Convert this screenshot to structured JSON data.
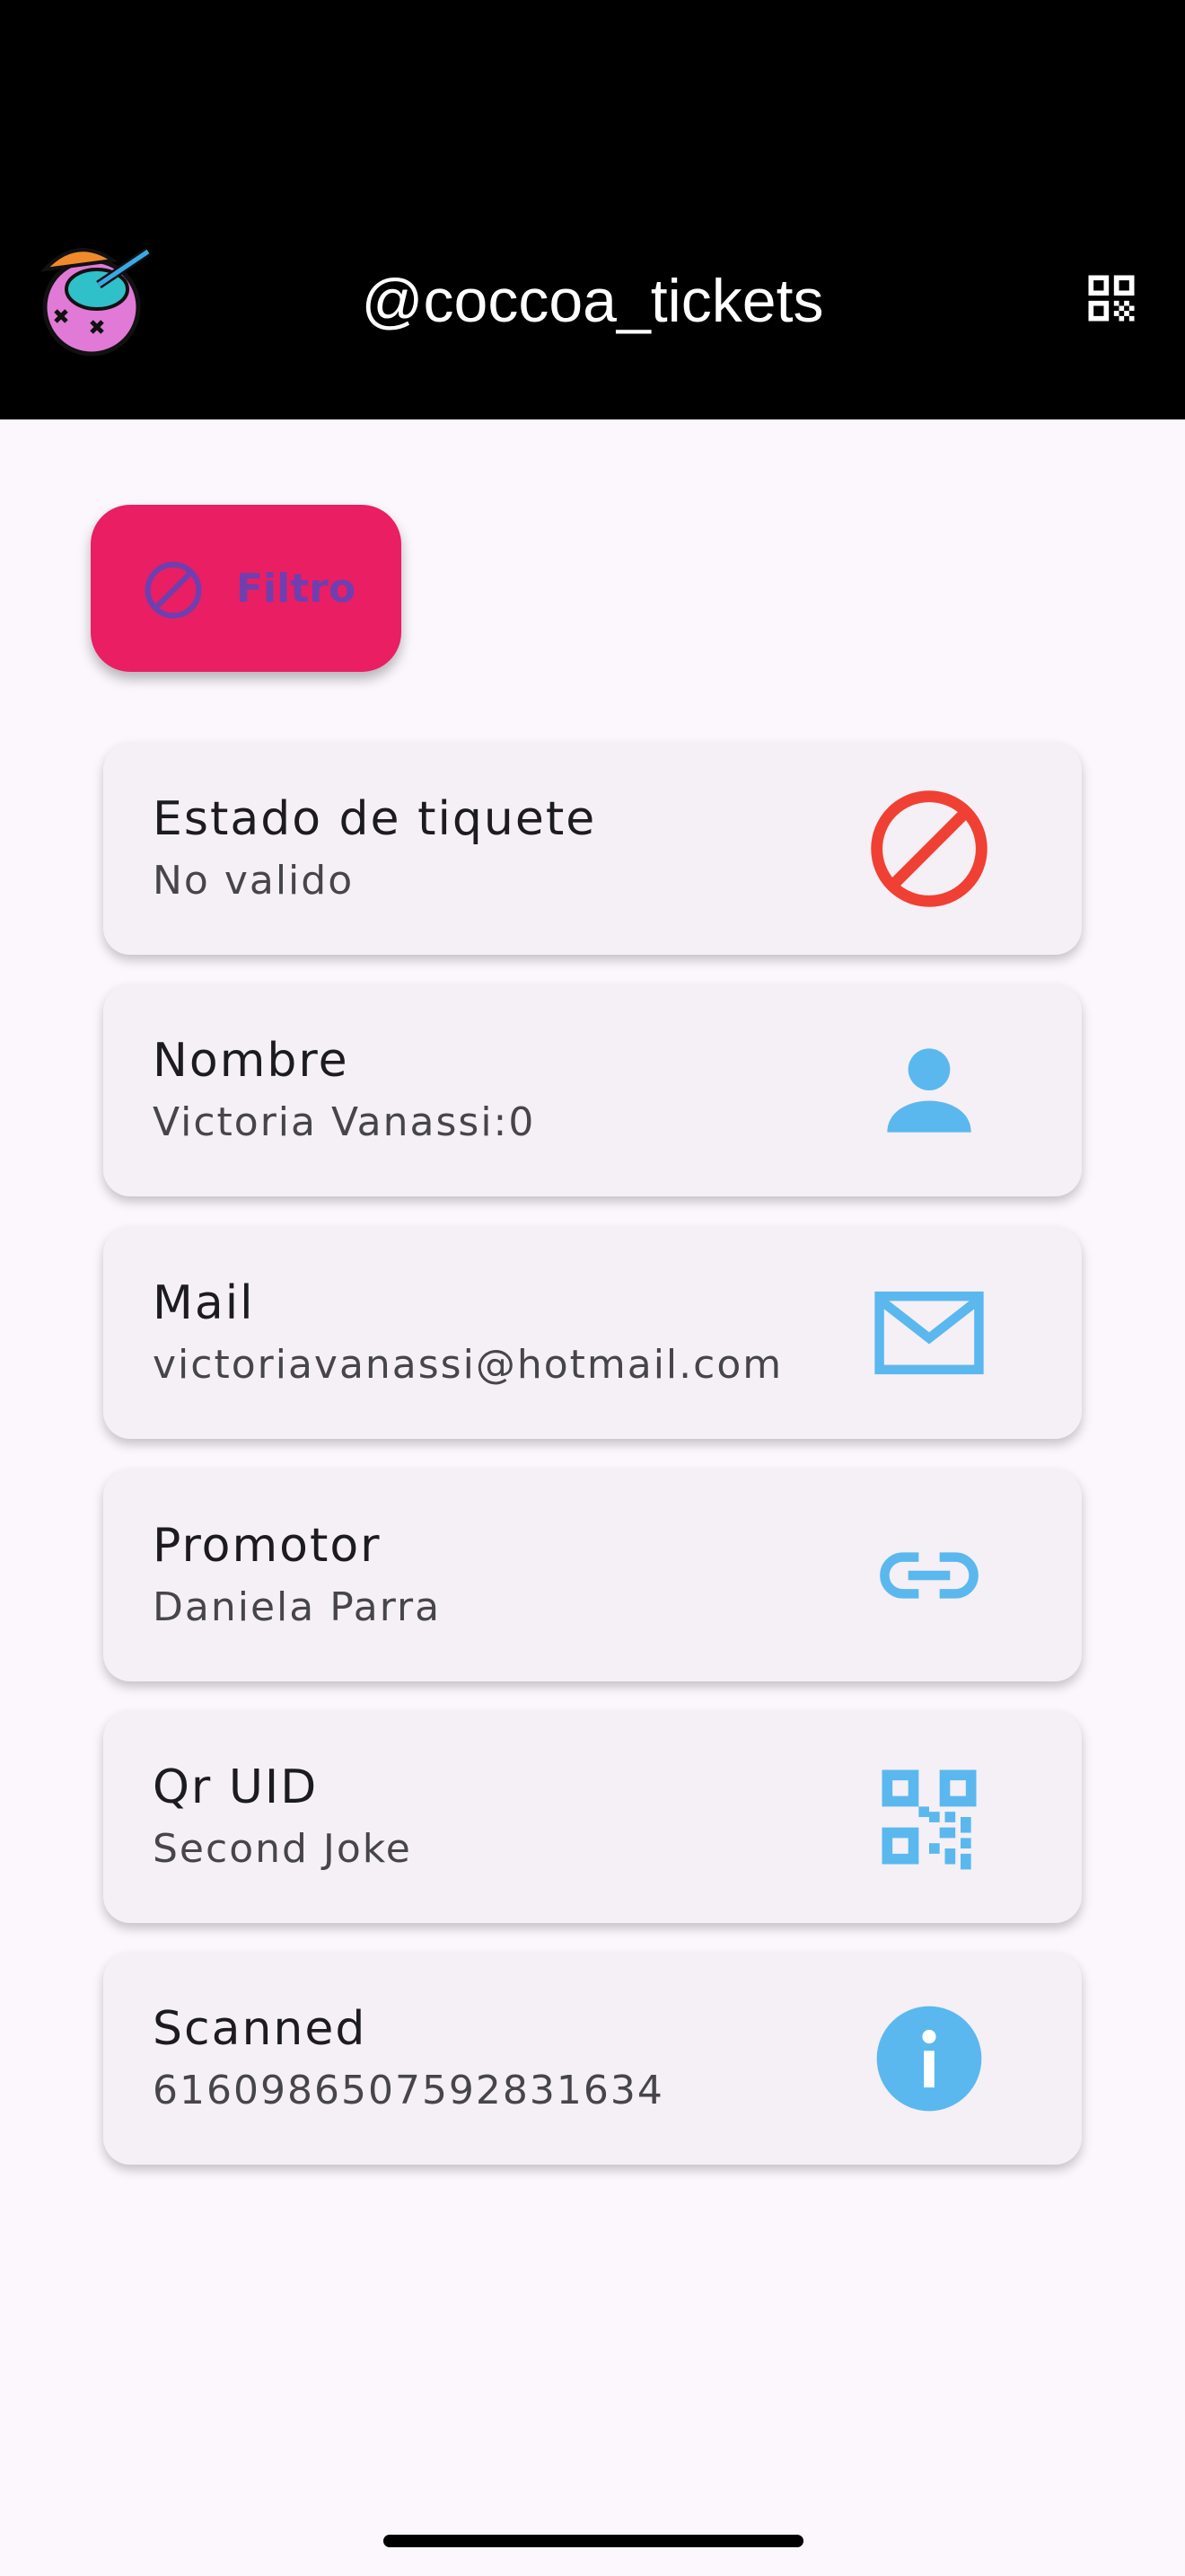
{
  "header": {
    "title": "@coccoa_tickets",
    "logo_icon": "coconut-drink-logo-icon",
    "qr_icon": "qr-code-icon"
  },
  "filter_button": {
    "label": "Filtro",
    "icon": "block-icon"
  },
  "cards": [
    {
      "label": "Estado de tiquete",
      "value": "No valido",
      "icon": "block-icon",
      "icon_color": "#f04034"
    },
    {
      "label": "Nombre",
      "value": "Victoria Vanassi:0",
      "icon": "person-icon",
      "icon_color": "#5bb8ee"
    },
    {
      "label": "Mail",
      "value": "victoriavanassi@hotmail.com",
      "icon": "mail-icon",
      "icon_color": "#5bb8ee"
    },
    {
      "label": "Promotor",
      "value": "Daniela Parra",
      "icon": "link-icon",
      "icon_color": "#5bb8ee"
    },
    {
      "label": "Qr UID",
      "value": "Second Joke",
      "icon": "qr-code-icon",
      "icon_color": "#5bb8ee"
    },
    {
      "label": "Scanned",
      "value": "6160986507592831634",
      "icon": "info-icon",
      "icon_color": "#5bb8ee"
    }
  ],
  "colors": {
    "appbar": "#000000",
    "background": "#fbf7fd",
    "filter_button": "#ea1e63",
    "filter_text": "#6f3fb0",
    "card": "#f4f0f6",
    "accent_blue": "#5bb8ee",
    "invalid_red": "#f04034"
  }
}
